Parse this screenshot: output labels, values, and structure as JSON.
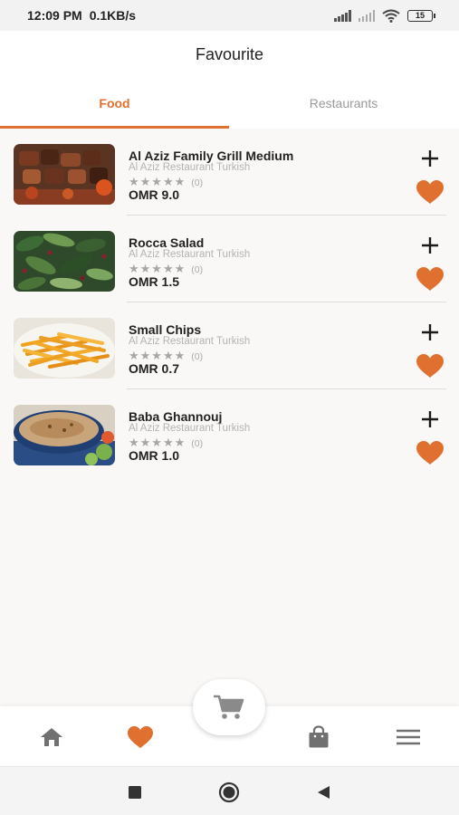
{
  "status_bar": {
    "time": "12:09 PM",
    "network_speed": "0.1KB/s",
    "battery": "15"
  },
  "header": {
    "title": "Favourite"
  },
  "tabs": [
    {
      "label": "Food",
      "active": true
    },
    {
      "label": "Restaurants",
      "active": false
    }
  ],
  "favourites": [
    {
      "name": "Al Aziz Family Grill Medium",
      "restaurant": "Al Aziz Restaurant Turkish",
      "stars": "★★★★★",
      "rating_count": "(0)",
      "price": "OMR 9.0",
      "image": "grilled-meat-skewers"
    },
    {
      "name": "Rocca Salad",
      "restaurant": "Al Aziz Restaurant Turkish",
      "stars": "★★★★★",
      "rating_count": "(0)",
      "price": "OMR 1.5",
      "image": "rocket-salad"
    },
    {
      "name": "Small Chips",
      "restaurant": "Al Aziz Restaurant Turkish",
      "stars": "★★★★★",
      "rating_count": "(0)",
      "price": "OMR 0.7",
      "image": "french-fries"
    },
    {
      "name": "Baba Ghannouj",
      "restaurant": "Al Aziz Restaurant Turkish",
      "stars": "★★★★★",
      "rating_count": "(0)",
      "price": "OMR 1.0",
      "image": "baba-ghannouj-dip"
    }
  ],
  "bottom_nav": {
    "items": [
      "home-icon",
      "heart-icon",
      "cart-icon",
      "bag-icon",
      "menu-icon"
    ],
    "active": "heart-icon"
  },
  "colors": {
    "accent": "#e07030",
    "icon_gray": "#707070"
  }
}
